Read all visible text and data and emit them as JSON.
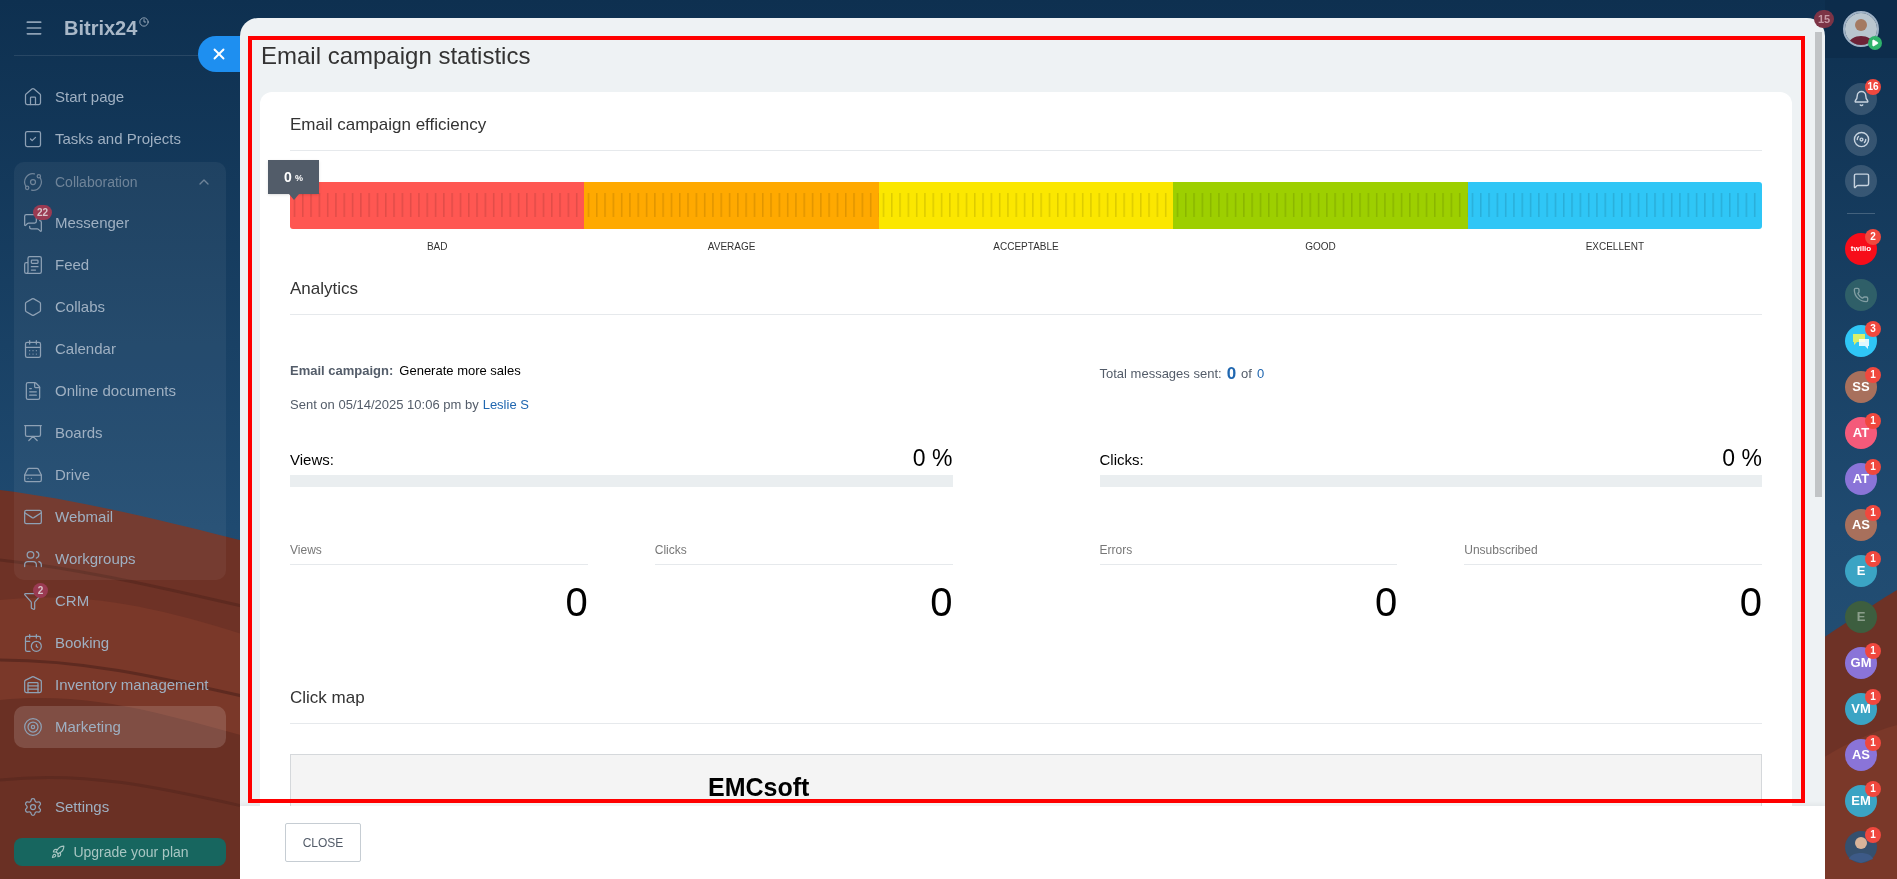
{
  "sidebar": {
    "logo": "Bitrix24",
    "items": [
      {
        "kind": "link",
        "label": "Start page",
        "selected": false
      },
      {
        "kind": "link",
        "label": "Tasks and Projects",
        "selected": false
      },
      {
        "kind": "group",
        "label": "Collaboration",
        "expanded": true,
        "children": [
          {
            "kind": "link",
            "label": "Messenger",
            "badge": "22",
            "selected": false
          },
          {
            "kind": "link",
            "label": "Feed",
            "selected": false
          },
          {
            "kind": "link",
            "label": "Collabs",
            "selected": false
          },
          {
            "kind": "link",
            "label": "Calendar",
            "selected": false
          },
          {
            "kind": "link",
            "label": "Online documents",
            "selected": false
          },
          {
            "kind": "link",
            "label": "Boards",
            "selected": false
          },
          {
            "kind": "link",
            "label": "Drive",
            "selected": false
          },
          {
            "kind": "link",
            "label": "Webmail",
            "selected": false
          },
          {
            "kind": "link",
            "label": "Workgroups",
            "selected": false
          }
        ]
      },
      {
        "kind": "link",
        "label": "CRM",
        "badge": "2",
        "selected": false
      },
      {
        "kind": "link",
        "label": "Booking",
        "selected": false
      },
      {
        "kind": "link",
        "label": "Inventory management",
        "selected": false
      },
      {
        "kind": "link",
        "label": "Marketing",
        "selected": true
      }
    ],
    "bottom_items": [
      {
        "kind": "link",
        "label": "Settings",
        "selected": false
      }
    ],
    "upgrade": "Upgrade your plan"
  },
  "modal": {
    "title": "Email campaign statistics",
    "footer_button": "CLOSE",
    "efficiency": {
      "title": "Email campaign efficiency",
      "level": 0,
      "value": "0",
      "unit": "%",
      "segments": [
        {
          "label": "BAD",
          "color": "#ff5752"
        },
        {
          "label": "AVERAGE",
          "color": "#ffa900"
        },
        {
          "label": "ACCEPTABLE",
          "color": "#fbe700"
        },
        {
          "label": "GOOD",
          "color": "#9dcf00"
        },
        {
          "label": "EXCELLENT",
          "color": "#2fc6f6"
        }
      ]
    },
    "analytics": {
      "title": "Analytics",
      "campaign_label": "Email campaign:",
      "campaign_name": "Generate more sales",
      "sent_text": "Sent on 05/14/2025 10:06 pm by",
      "sender": "Leslie S",
      "total_label": "Total messages sent:",
      "total_sent": "0",
      "total_of": "of",
      "total_count": "0",
      "rates": [
        {
          "label": "Views:",
          "reading": "0 %",
          "level": 0
        },
        {
          "label": "Clicks:",
          "reading": "0 %",
          "level": 0
        }
      ],
      "counters": [
        {
          "label": "Views",
          "value": "0"
        },
        {
          "label": "Clicks",
          "value": "0"
        },
        {
          "label": "Errors",
          "value": "0"
        },
        {
          "label": "Unsubscribed",
          "value": "0"
        }
      ]
    },
    "click_map": {
      "title": "Click map",
      "preview_heading": "EMCsoft"
    }
  },
  "right_bar": {
    "counter": "15",
    "tools": [
      {
        "kind": "bell",
        "badge": "16"
      },
      {
        "kind": "spiral"
      },
      {
        "kind": "chat"
      }
    ],
    "contacts": [
      {
        "kind": "app",
        "label": "twilio",
        "badge": "2",
        "color": "#f70d1a",
        "disabled": false
      },
      {
        "kind": "phone",
        "color": "#2f5f68",
        "disabled": true
      },
      {
        "kind": "chat",
        "badge": "3",
        "color": "#2fc6f6",
        "disabled": false
      },
      {
        "kind": "initials",
        "initials": "SS",
        "badge": "1",
        "color": "#a8705c",
        "disabled": false
      },
      {
        "kind": "initials",
        "initials": "AT",
        "badge": "1",
        "color": "#f45a7a",
        "disabled": false
      },
      {
        "kind": "initials",
        "initials": "AT",
        "badge": "1",
        "color": "#8a74d8",
        "disabled": false
      },
      {
        "kind": "initials",
        "initials": "AS",
        "badge": "1",
        "color": "#a8705c",
        "disabled": false
      },
      {
        "kind": "initials",
        "initials": "E",
        "badge": "1",
        "color": "#3ba4c4",
        "disabled": false
      },
      {
        "kind": "initials",
        "initials": "E",
        "color": "#3d5e3f",
        "disabled": true
      },
      {
        "kind": "initials",
        "initials": "GM",
        "badge": "1",
        "color": "#8a74d8",
        "disabled": false
      },
      {
        "kind": "initials",
        "initials": "VM",
        "badge": "1",
        "color": "#3ba4c4",
        "disabled": false
      },
      {
        "kind": "initials",
        "initials": "AS",
        "badge": "1",
        "color": "#8a74d8",
        "disabled": false
      },
      {
        "kind": "initials",
        "initials": "EM",
        "badge": "1",
        "color": "#3ba4c4",
        "disabled": false
      },
      {
        "badge": "1",
        "color": "#35506e",
        "disabled": false
      }
    ]
  }
}
